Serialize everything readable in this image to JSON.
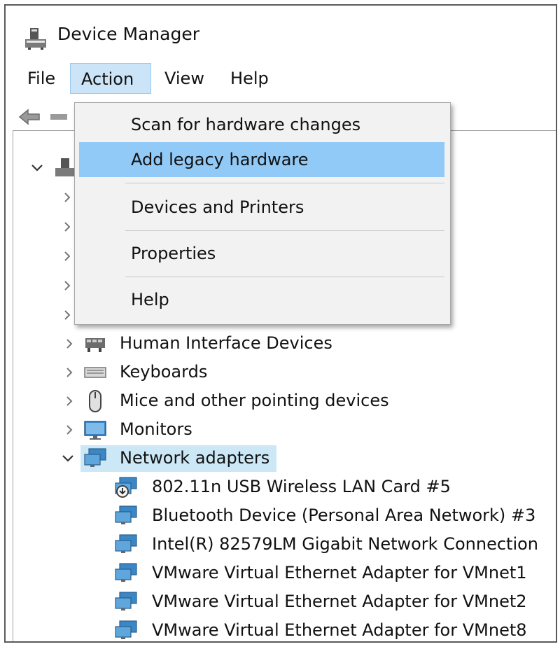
{
  "window": {
    "title": "Device Manager"
  },
  "menubar": {
    "file": "File",
    "action": "Action",
    "view": "View",
    "help": "Help"
  },
  "action_menu": {
    "items": [
      "Scan for hardware changes",
      "Add legacy hardware",
      "Devices and Printers",
      "Properties",
      "Help"
    ],
    "highlighted_index": 1
  },
  "tree": {
    "categories": [
      {
        "label": "Human Interface Devices",
        "icon": "hid-icon",
        "expanded": false
      },
      {
        "label": "Keyboards",
        "icon": "keyboard-icon",
        "expanded": false
      },
      {
        "label": "Mice and other pointing devices",
        "icon": "mouse-icon",
        "expanded": false
      },
      {
        "label": "Monitors",
        "icon": "monitor-icon",
        "expanded": false
      },
      {
        "label": "Network adapters",
        "icon": "network-adapter-icon",
        "expanded": true,
        "selected": true
      }
    ],
    "network_adapters": [
      "802.11n USB Wireless LAN Card #5",
      "Bluetooth Device (Personal Area Network) #3",
      "Intel(R) 82579LM Gigabit Network Connection",
      "VMware Virtual Ethernet Adapter for VMnet1",
      "VMware Virtual Ethernet Adapter for VMnet2",
      "VMware Virtual Ethernet Adapter for VMnet8"
    ]
  },
  "colors": {
    "menu_active_bg": "#cce4f7",
    "menu_highlight_bg": "#91c9f7",
    "selection_bg": "#cce8f7"
  }
}
